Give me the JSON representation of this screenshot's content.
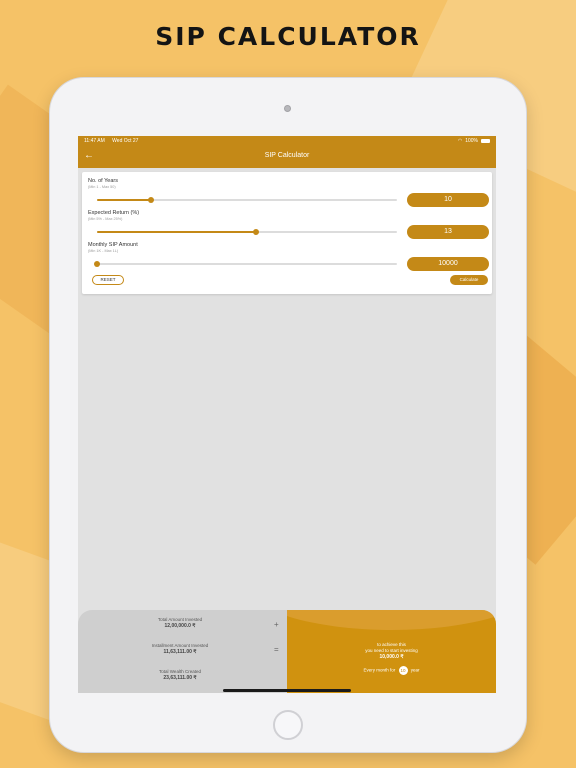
{
  "promo": {
    "title": "SIP CALCULATOR"
  },
  "status_bar": {
    "time": "11:47 AM",
    "date": "Wed Oct 27",
    "battery": "100%"
  },
  "nav": {
    "title": "SIP Calculator",
    "back_icon": "arrow-left-icon"
  },
  "form": {
    "fields": [
      {
        "label": "No. of Years",
        "range": "(Min 1 - Max 50)",
        "value": "10",
        "fraction": 0.18
      },
      {
        "label": "Expected Return (%)",
        "range": "(Min 5% - Max 25%)",
        "value": "13",
        "fraction": 0.53
      },
      {
        "label": "Monthly SIP Amount",
        "range": "(Min 1K - Max 1L)",
        "value": "10000",
        "fraction": 0.0
      }
    ],
    "reset_label": "RESET",
    "calculate_label": "Calculate"
  },
  "results": {
    "total_invested_label": "Total Amount Invested",
    "total_invested_value": "12,00,000.0 ₹",
    "installment_label": "Installment Amount Invested",
    "installment_value": "11,63,111.00 ₹",
    "wealth_label": "Total Wealth Created",
    "wealth_value": "23,63,111.00 ₹",
    "plus_symbol": "+",
    "equals_symbol": "=",
    "target_line1": "to achieve this",
    "target_line2": "you need to start investing",
    "target_amount": "10,000.0 ₹",
    "every_month_prefix": "Every month for",
    "years": "10",
    "years_suffix": "year"
  },
  "colors": {
    "accent": "#c48917",
    "background": "#f5c267",
    "screen": "#e1e1e1"
  }
}
